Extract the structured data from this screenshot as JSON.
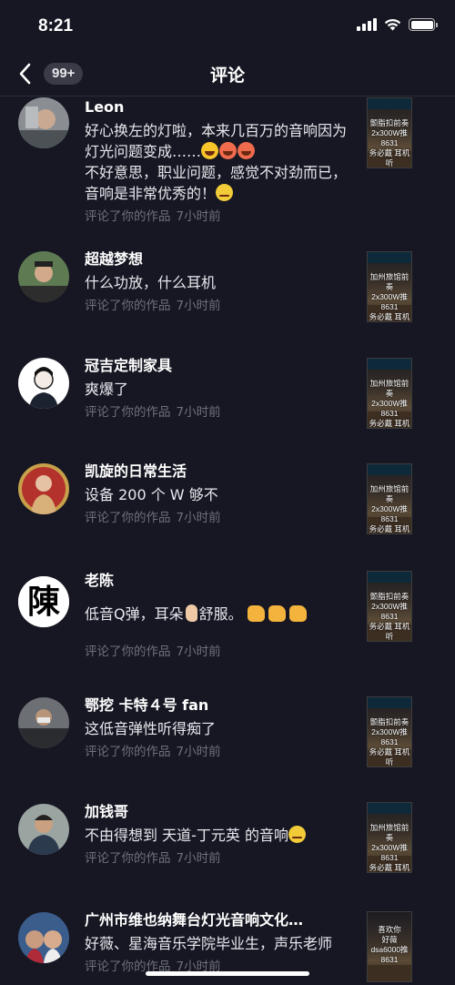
{
  "status_bar": {
    "time": "8:21"
  },
  "nav": {
    "badge": "99+",
    "title": "评论"
  },
  "comments": [
    {
      "username": "Leon",
      "text_1": "好心换左的灯啦，本来几百万的音响因为灯光问题变成……",
      "text_2": "不好意思，职业问题，感觉不对劲而已，音响是非常优秀的！",
      "action": "评论了你的作品",
      "time": "7小时前",
      "thumbnail_text": "颤脂扣前奏\n2x300W推8631\n务必戴    耳机听"
    },
    {
      "username": "超越梦想",
      "text": "什么功放，什么耳机",
      "action": "评论了你的作品",
      "time": "7小时前",
      "thumbnail_text": "加州旅馆前奏\n2x300W推8631\n务必戴    耳机听"
    },
    {
      "username": "冠吉定制家具",
      "text": "爽爆了",
      "action": "评论了你的作品",
      "time": "7小时前",
      "thumbnail_text": "加州旅馆前奏\n2x300W推8631\n务必戴    耳机听"
    },
    {
      "username": "凯旋的日常生活",
      "text": "设备 200 个 W 够不",
      "action": "评论了你的作品",
      "time": "7小时前",
      "thumbnail_text": "加州旅馆前奏\n2x300W推8631\n务必戴    耳机听"
    },
    {
      "username": "老陈",
      "text_a": "低音Q弹，耳朵",
      "text_b": "舒服。",
      "action": "评论了你的作品",
      "time": "7小时前",
      "avatar_char": "陳",
      "thumbnail_text": "颤脂扣前奏\n2x300W推8631\n务必戴    耳机听"
    },
    {
      "username": "鄂挖   卡特４号 fan",
      "text": "这低音弹性听得痴了",
      "action": "评论了你的作品",
      "time": "7小时前",
      "thumbnail_text": "颤脂扣前奏\n2x300W推8631\n务必戴    耳机听"
    },
    {
      "username": "加钱哥",
      "text": "不由得想到 天道-丁元英 的音响",
      "action": "评论了你的作品",
      "time": "7小时前",
      "thumbnail_text": "加州旅馆前奏\n2x300W推8631\n务必戴    耳机听"
    },
    {
      "username": "广州市维也纳舞台灯光音响文化…",
      "text": "好薇、星海音乐学院毕业生，声乐老师",
      "action": "评论了你的作品",
      "time": "7小时前",
      "thumbnail_text": "喜欢你\n好薇\ndsa6000推8631"
    }
  ]
}
